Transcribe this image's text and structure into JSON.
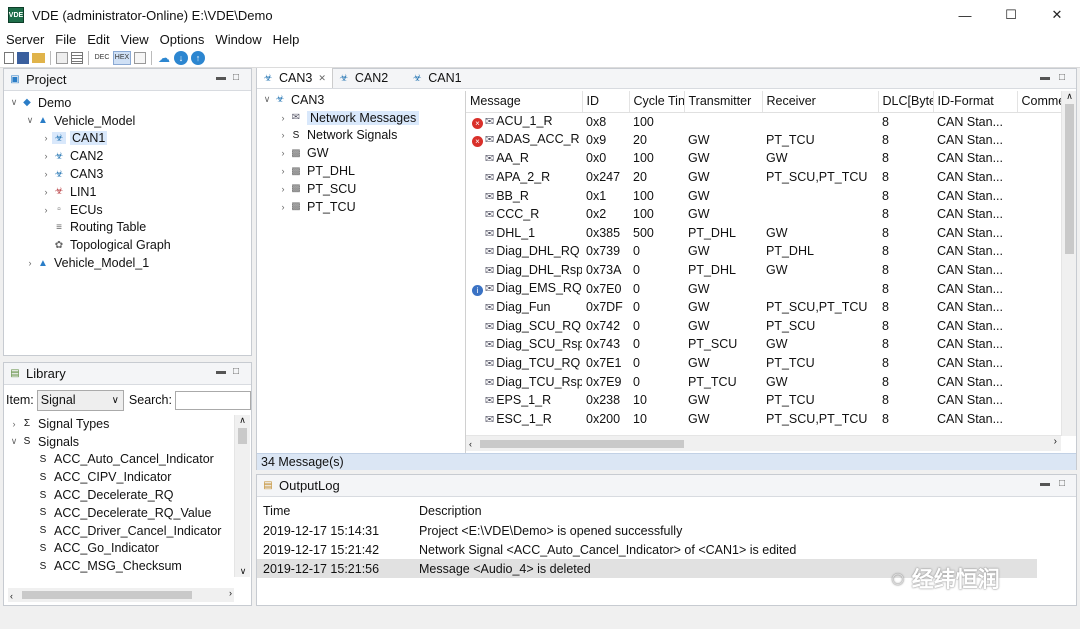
{
  "window": {
    "title": "VDE (administrator-Online)  E:\\VDE\\Demo",
    "app_icon_text": "VDE"
  },
  "menu": [
    "Server",
    "File",
    "Edit",
    "View",
    "Options",
    "Window",
    "Help"
  ],
  "toolbar_icons": [
    "new-file-icon",
    "save-icon",
    "open-folder-icon",
    "properties-icon",
    "list-icon",
    "dec-icon",
    "hex-icon",
    "export-icon",
    "cloud-icon",
    "download-icon",
    "upload-icon"
  ],
  "toolbar": {
    "dec_label": "DEC",
    "hex_label": "HEX"
  },
  "project": {
    "title": "Project",
    "tree": [
      {
        "label": "Demo"
      },
      {
        "label": "Vehicle_Model"
      },
      {
        "label": "CAN1"
      },
      {
        "label": "CAN2"
      },
      {
        "label": "CAN3"
      },
      {
        "label": "LIN1"
      },
      {
        "label": "ECUs"
      },
      {
        "label": "Routing Table"
      },
      {
        "label": "Topological Graph"
      },
      {
        "label": "Vehicle_Model_1"
      }
    ]
  },
  "library": {
    "title": "Library",
    "item_label": "Item:",
    "item_value": "Signal",
    "search_label": "Search:",
    "search_value": "",
    "groups": [
      "Signal Types",
      "Signals"
    ],
    "signals": [
      "ACC_Auto_Cancel_Indicator",
      "ACC_CIPV_Indicator",
      "ACC_Decelerate_RQ",
      "ACC_Decelerate_RQ_Value",
      "ACC_Driver_Cancel_Indicator",
      "ACC_Go_Indicator",
      "ACC_MSG_Checksum"
    ]
  },
  "editor": {
    "tabs": [
      "CAN3",
      "CAN2",
      "CAN1"
    ],
    "tree": {
      "root": "CAN3",
      "items": [
        "Network Messages",
        "Network Signals",
        "GW",
        "PT_DHL",
        "PT_SCU",
        "PT_TCU"
      ]
    },
    "columns": [
      "Message",
      "ID",
      "Cycle Tin",
      "Transmitter",
      "Receiver",
      "DLC[Byte",
      "ID-Format",
      "Comme"
    ],
    "rows": [
      {
        "message": "ACU_1_R",
        "id": "0x8",
        "cycle": "100",
        "tx": "",
        "rx": "",
        "dlc": "8",
        "fmt": "CAN Stan...",
        "status": "error"
      },
      {
        "message": "ADAS_ACC_R",
        "id": "0x9",
        "cycle": "20",
        "tx": "GW",
        "rx": "PT_TCU",
        "dlc": "8",
        "fmt": "CAN Stan...",
        "status": "error"
      },
      {
        "message": "AA_R",
        "id": "0x0",
        "cycle": "100",
        "tx": "GW",
        "rx": "GW",
        "dlc": "8",
        "fmt": "CAN Stan...",
        "status": ""
      },
      {
        "message": "APA_2_R",
        "id": "0x247",
        "cycle": "20",
        "tx": "GW",
        "rx": "PT_SCU,PT_TCU",
        "dlc": "8",
        "fmt": "CAN Stan...",
        "status": ""
      },
      {
        "message": "BB_R",
        "id": "0x1",
        "cycle": "100",
        "tx": "GW",
        "rx": "",
        "dlc": "8",
        "fmt": "CAN Stan...",
        "status": ""
      },
      {
        "message": "CCC_R",
        "id": "0x2",
        "cycle": "100",
        "tx": "GW",
        "rx": "",
        "dlc": "8",
        "fmt": "CAN Stan...",
        "status": ""
      },
      {
        "message": "DHL_1",
        "id": "0x385",
        "cycle": "500",
        "tx": "PT_DHL",
        "rx": "GW",
        "dlc": "8",
        "fmt": "CAN Stan...",
        "status": ""
      },
      {
        "message": "Diag_DHL_RQ",
        "id": "0x739",
        "cycle": "0",
        "tx": "GW",
        "rx": "PT_DHL",
        "dlc": "8",
        "fmt": "CAN Stan...",
        "status": ""
      },
      {
        "message": "Diag_DHL_Rsp",
        "id": "0x73A",
        "cycle": "0",
        "tx": "PT_DHL",
        "rx": "GW",
        "dlc": "8",
        "fmt": "CAN Stan...",
        "status": ""
      },
      {
        "message": "Diag_EMS_RQ",
        "id": "0x7E0",
        "cycle": "0",
        "tx": "GW",
        "rx": "",
        "dlc": "8",
        "fmt": "CAN Stan...",
        "status": "info"
      },
      {
        "message": "Diag_Fun",
        "id": "0x7DF",
        "cycle": "0",
        "tx": "GW",
        "rx": "PT_SCU,PT_TCU",
        "dlc": "8",
        "fmt": "CAN Stan...",
        "status": ""
      },
      {
        "message": "Diag_SCU_RQ",
        "id": "0x742",
        "cycle": "0",
        "tx": "GW",
        "rx": "PT_SCU",
        "dlc": "8",
        "fmt": "CAN Stan...",
        "status": ""
      },
      {
        "message": "Diag_SCU_Rsp",
        "id": "0x743",
        "cycle": "0",
        "tx": "PT_SCU",
        "rx": "GW",
        "dlc": "8",
        "fmt": "CAN Stan...",
        "status": ""
      },
      {
        "message": "Diag_TCU_RQ",
        "id": "0x7E1",
        "cycle": "0",
        "tx": "GW",
        "rx": "PT_TCU",
        "dlc": "8",
        "fmt": "CAN Stan...",
        "status": ""
      },
      {
        "message": "Diag_TCU_Rsp",
        "id": "0x7E9",
        "cycle": "0",
        "tx": "PT_TCU",
        "rx": "GW",
        "dlc": "8",
        "fmt": "CAN Stan...",
        "status": ""
      },
      {
        "message": "EPS_1_R",
        "id": "0x238",
        "cycle": "10",
        "tx": "GW",
        "rx": "PT_TCU",
        "dlc": "8",
        "fmt": "CAN Stan...",
        "status": ""
      },
      {
        "message": "ESC_1_R",
        "id": "0x200",
        "cycle": "10",
        "tx": "GW",
        "rx": "PT_SCU,PT_TCU",
        "dlc": "8",
        "fmt": "CAN Stan...",
        "status": ""
      }
    ],
    "status_text": "34 Message(s)"
  },
  "output_log": {
    "title": "OutputLog",
    "columns": [
      "Time",
      "Description"
    ],
    "rows": [
      {
        "time": "2019-12-17 15:14:31",
        "desc": "Project <E:\\VDE\\Demo> is opened successfully"
      },
      {
        "time": "2019-12-17 15:21:42",
        "desc": "Network Signal <ACC_Auto_Cancel_Indicator> of <CAN1> is edited"
      },
      {
        "time": "2019-12-17 15:21:56",
        "desc": "Message <Audio_4> is deleted"
      }
    ]
  },
  "watermark": {
    "text": "经纬恒润"
  },
  "colors": {
    "selection": "#d9e8fb",
    "error": "#d9302a",
    "info": "#3a72c4"
  }
}
